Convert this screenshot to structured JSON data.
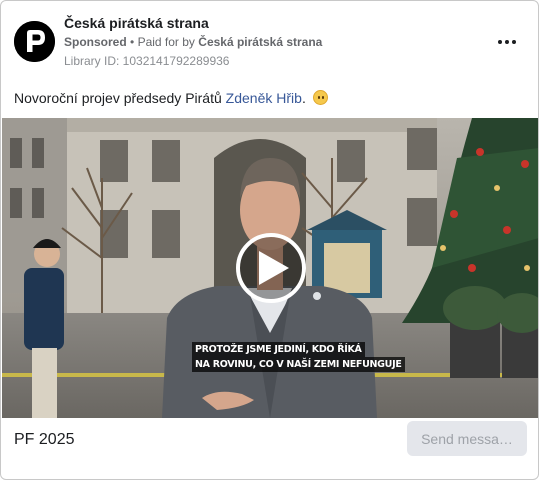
{
  "ad": {
    "page_name": "Česká pirátská strana",
    "sponsored_label": "Sponsored",
    "separator": "•",
    "paid_for_prefix": "Paid for by",
    "paid_for_by": "Česká pirátská strana",
    "library_id": "Library ID: 1032141792289936",
    "more_options_icon": "ellipsis-icon",
    "avatar_icon": "pirate-party-logo"
  },
  "caption": {
    "text_before": "Novoroční projev předsedy Pirátů ",
    "mention": "Zdeněk Hřib",
    "text_after": ".",
    "emoji": "slightly-smiling-face-emoji"
  },
  "video": {
    "play_icon": "play-icon",
    "subtitle_line_1": "PROTOŽE JSME JEDINÍ, KDO ŘÍKÁ",
    "subtitle_line_2": "NA ROVINU, CO V NAŠÍ ZEMI NEFUNGUJE"
  },
  "footer": {
    "title": "PF 2025",
    "send_button_label": "Send messa…"
  }
}
